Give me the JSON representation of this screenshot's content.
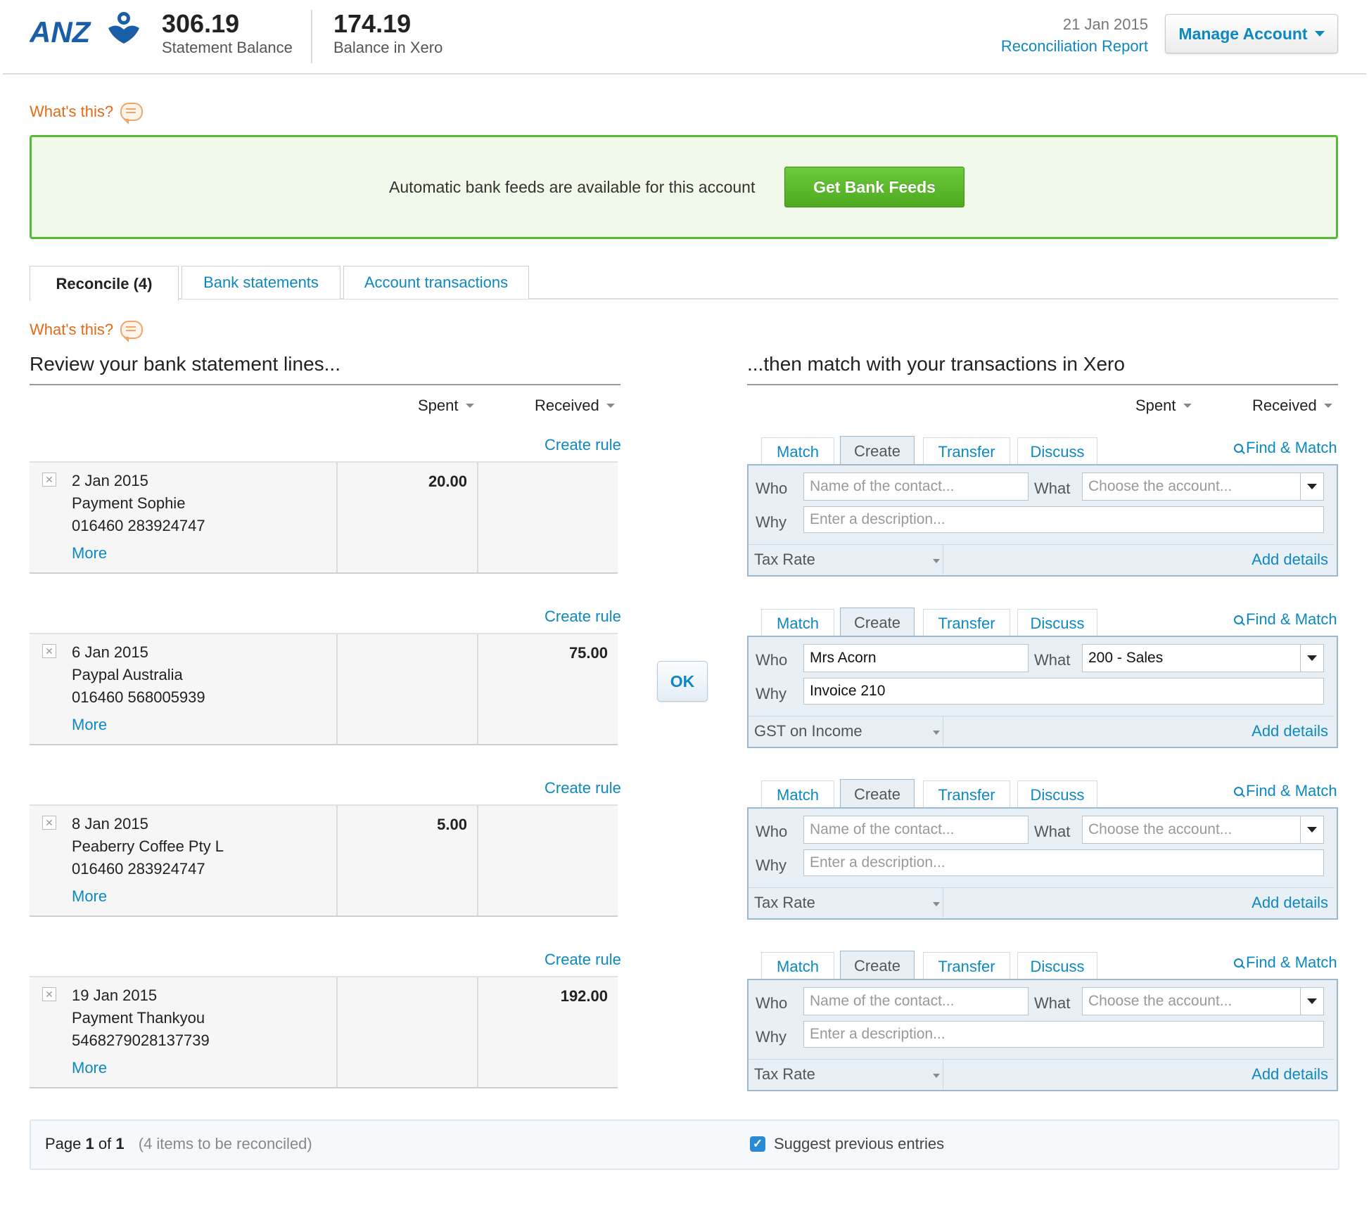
{
  "header": {
    "logo_text": "ANZ",
    "statement_balance": "306.19",
    "statement_balance_label": "Statement Balance",
    "xero_balance": "174.19",
    "xero_balance_label": "Balance in Xero",
    "date": "21 Jan 2015",
    "report_link": "Reconciliation Report",
    "manage_account": "Manage Account"
  },
  "whats_this": "What's this?",
  "banner": {
    "text": "Automatic bank feeds are available for this account",
    "button": "Get Bank Feeds"
  },
  "tabs": [
    "Reconcile (4)",
    "Bank statements",
    "Account transactions"
  ],
  "left": {
    "title": "Review your bank statement lines...",
    "spent": "Spent",
    "received": "Received",
    "create_rule": "Create rule",
    "more": "More"
  },
  "right": {
    "title": "...then match with your transactions in Xero",
    "spent": "Spent",
    "received": "Received",
    "tabs": [
      "Match",
      "Create",
      "Transfer",
      "Discuss"
    ],
    "find_match": "Find & Match",
    "who": "Who",
    "what": "What",
    "why": "Why",
    "add_details": "Add details",
    "who_placeholder": "Name of the contact...",
    "what_placeholder": "Choose the account...",
    "why_placeholder": "Enter a description..."
  },
  "ok_button": "OK",
  "lines": [
    {
      "date": "2 Jan 2015",
      "payee": "Payment Sophie",
      "ref": "016460 283924747",
      "spent": "20.00",
      "received": "",
      "who": "",
      "what": "",
      "why": "",
      "tax": "Tax Rate"
    },
    {
      "date": "6 Jan 2015",
      "payee": "Paypal Australia",
      "ref": "016460 568005939",
      "spent": "",
      "received": "75.00",
      "who": "Mrs Acorn",
      "what": "200 - Sales",
      "why": "Invoice 210",
      "tax": "GST on Income"
    },
    {
      "date": "8 Jan 2015",
      "payee": "Peaberry Coffee Pty L",
      "ref": "016460 283924747",
      "spent": "5.00",
      "received": "",
      "who": "",
      "what": "",
      "why": "",
      "tax": "Tax Rate"
    },
    {
      "date": "19 Jan 2015",
      "payee": "Payment Thankyou",
      "ref": "5468279028137739",
      "spent": "",
      "received": "192.00",
      "who": "",
      "what": "",
      "why": "",
      "tax": "Tax Rate"
    }
  ],
  "footer": {
    "page_prefix": "Page",
    "page": "1",
    "of": "of",
    "total": "1",
    "items_note": "(4 items to be reconciled)",
    "suggest": "Suggest previous entries",
    "suggest_checked": true
  },
  "colors": {
    "accent": "#0d88c1",
    "green": "#58b837",
    "orange": "#e06c1a"
  }
}
